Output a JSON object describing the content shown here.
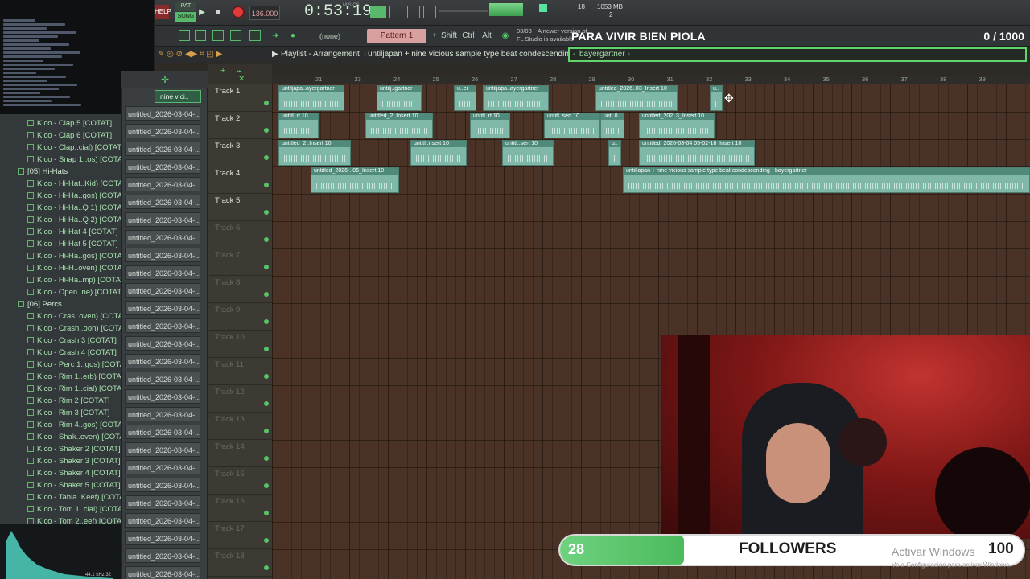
{
  "toolbar": {
    "help_label": "HELP",
    "song_label": "SONG",
    "pat_label": "PAT",
    "tempo": "136.000",
    "time": "0:53:19",
    "time_sub": "M:S:CS",
    "cpu": "18",
    "mem": "1053 MB",
    "mem_sub": "2",
    "none_label": "(none)",
    "pattern_label": "Pattern 1",
    "shift_label": "Shift",
    "ctrl_label": "Ctrl",
    "alt_label": "Alt",
    "news_date": "03/03",
    "news_text": "A newer version of",
    "news_text2": "FL Studio is available"
  },
  "overlay": {
    "song_title": "PARA VIVIR BIEN PIOLA",
    "counter": "0  / 1000"
  },
  "playlist_bar": {
    "label": "Playlist - Arrangement",
    "song_name": "untiljapan + nine vicious sample type beat condescending",
    "artist": "bayergartner",
    "channel_selected": "nine vici.."
  },
  "ruler_ticks": [
    "21",
    "23",
    "24",
    "25",
    "26",
    "27",
    "28",
    "29",
    "30",
    "31",
    "32",
    "33",
    "34",
    "35",
    "36",
    "37",
    "38",
    "39"
  ],
  "tracks": [
    {
      "name": "Track 1",
      "dim": false
    },
    {
      "name": "Track 2",
      "dim": false
    },
    {
      "name": "Track 3",
      "dim": false
    },
    {
      "name": "Track 4",
      "dim": false
    },
    {
      "name": "Track 5",
      "dim": false
    },
    {
      "name": "Track 6",
      "dim": true
    },
    {
      "name": "Track 7",
      "dim": true
    },
    {
      "name": "Track 8",
      "dim": true
    },
    {
      "name": "Track 9",
      "dim": true
    },
    {
      "name": "Track 10",
      "dim": true
    },
    {
      "name": "Track 11",
      "dim": true
    },
    {
      "name": "Track 12",
      "dim": true
    },
    {
      "name": "Track 13",
      "dim": true
    },
    {
      "name": "Track 14",
      "dim": true
    },
    {
      "name": "Track 15",
      "dim": true
    },
    {
      "name": "Track 16",
      "dim": true
    },
    {
      "name": "Track 17",
      "dim": true
    },
    {
      "name": "Track 18",
      "dim": true
    }
  ],
  "clips": [
    {
      "track": 0,
      "start": 346,
      "end": 428,
      "label": "untiljapa..ayergartner"
    },
    {
      "track": 0,
      "start": 468,
      "end": 524,
      "label": "untilj..gartner"
    },
    {
      "track": 0,
      "start": 564,
      "end": 592,
      "label": "u..er"
    },
    {
      "track": 0,
      "start": 600,
      "end": 682,
      "label": "untiljapa..ayergartner"
    },
    {
      "track": 0,
      "start": 740,
      "end": 842,
      "label": "untitled_2026..03_Insert 10"
    },
    {
      "track": 0,
      "start": 882,
      "end": 898,
      "label": "u.."
    },
    {
      "track": 1,
      "start": 346,
      "end": 396,
      "label": "untitl..rt 10"
    },
    {
      "track": 1,
      "start": 454,
      "end": 538,
      "label": "untitled_2..Insert 10"
    },
    {
      "track": 1,
      "start": 584,
      "end": 634,
      "label": "untitl..rt 10"
    },
    {
      "track": 1,
      "start": 676,
      "end": 746,
      "label": "untitl..sert 10"
    },
    {
      "track": 1,
      "start": 746,
      "end": 776,
      "label": "unt..0"
    },
    {
      "track": 1,
      "start": 794,
      "end": 888,
      "label": "untitled_202..3_Insert 10"
    },
    {
      "track": 2,
      "start": 346,
      "end": 436,
      "label": "untitled_2..Insert 10"
    },
    {
      "track": 2,
      "start": 510,
      "end": 580,
      "label": "untitl..nsert 10"
    },
    {
      "track": 2,
      "start": 624,
      "end": 688,
      "label": "untitl..sert 10"
    },
    {
      "track": 2,
      "start": 756,
      "end": 772,
      "label": "u.."
    },
    {
      "track": 2,
      "start": 794,
      "end": 938,
      "label": "untitled_2026-03-04 05-02-18_Insert 10"
    },
    {
      "track": 3,
      "start": 386,
      "end": 496,
      "label": "untitled_2026-..06_Insert 10"
    },
    {
      "track": 3,
      "start": 774,
      "end": 1280,
      "label": "untiljapan + nine vicious sample type beat condescending - bayergartner"
    }
  ],
  "browser": {
    "items": [
      {
        "label": "Kico - Clap 5 [COTAT]",
        "folder": false
      },
      {
        "label": "Kico - Clap 6 [COTAT]",
        "folder": false
      },
      {
        "label": "Kico - Clap..cial) [COTAT]",
        "folder": false
      },
      {
        "label": "Kico - Snap 1..os) [COTAT]",
        "folder": false
      },
      {
        "label": "[05] Hi-Hats",
        "folder": true
      },
      {
        "label": "Kico - Hi-Hat..Kid) [COTAT]",
        "folder": false
      },
      {
        "label": "Kico - Hi-Ha..gos) [COTAT]",
        "folder": false
      },
      {
        "label": "Kico - Hi-Ha..Q 1) [COTAT]",
        "folder": false
      },
      {
        "label": "Kico - Hi-Ha..Q 2) [COTAT]",
        "folder": false
      },
      {
        "label": "Kico - Hi-Hat 4 [COTAT]",
        "folder": false
      },
      {
        "label": "Kico - Hi-Hat 5 [COTAT]",
        "folder": false
      },
      {
        "label": "Kico - Hi-Ha..gos) [COTAT]",
        "folder": false
      },
      {
        "label": "Kico - Hi-H..oven) [COTAT]",
        "folder": false
      },
      {
        "label": "Kico - Hi-Ha..mp) [COTAT]",
        "folder": false
      },
      {
        "label": "Kico - Open..ne) [COTAT]",
        "folder": false
      },
      {
        "label": "[06] Percs",
        "folder": true
      },
      {
        "label": "Kico - Cras..oven) [COTAT]",
        "folder": false
      },
      {
        "label": "Kico - Crash..ooh) [COTAT]",
        "folder": false
      },
      {
        "label": "Kico - Crash 3 [COTAT]",
        "folder": false
      },
      {
        "label": "Kico - Crash 4 [COTAT]",
        "folder": false
      },
      {
        "label": "Kico - Perc 1..gos) [COTAT]",
        "folder": false
      },
      {
        "label": "Kico - Rim 1..erb) [COTAT]",
        "folder": false
      },
      {
        "label": "Kico - Rim 1..cial) [COTAT]",
        "folder": false
      },
      {
        "label": "Kico - Rim 2 [COTAT]",
        "folder": false
      },
      {
        "label": "Kico - Rim 3 [COTAT]",
        "folder": false
      },
      {
        "label": "Kico - Rim 4..gos) [COTAT]",
        "folder": false
      },
      {
        "label": "Kico - Shak..oven) [COTAT]",
        "folder": false
      },
      {
        "label": "Kico - Shaker 2 [COTAT]",
        "folder": false
      },
      {
        "label": "Kico - Shaker 3 [COTAT]",
        "folder": false
      },
      {
        "label": "Kico - Shaker 4 [COTAT]",
        "folder": false
      },
      {
        "label": "Kico - Shaker 5 [COTAT]",
        "folder": false
      },
      {
        "label": "Kico - Tabla..Keef) [COTAT]",
        "folder": false
      },
      {
        "label": "Kico - Tom 1..cial) [COTAT]",
        "folder": false
      },
      {
        "label": "Kico - Tom 2..eef) [COTAT]",
        "folder": false
      }
    ],
    "preview_info": "44.1 kHz 32"
  },
  "channels": {
    "label": "untitled_2026-03-04-...",
    "count": 27
  },
  "followers": {
    "count": "28",
    "label": "FOLLOWERS",
    "goal": "100",
    "progress": 0.28
  },
  "windows_watermark": {
    "line1": "Activar Windows",
    "line2": "Ve a Configuración para activar Windows."
  },
  "colors": {
    "accent_green": "#63d46b",
    "clip_fill": "#7fb7a9",
    "playlist_bg": "#4a3326",
    "webcam_red": "#c23330"
  }
}
